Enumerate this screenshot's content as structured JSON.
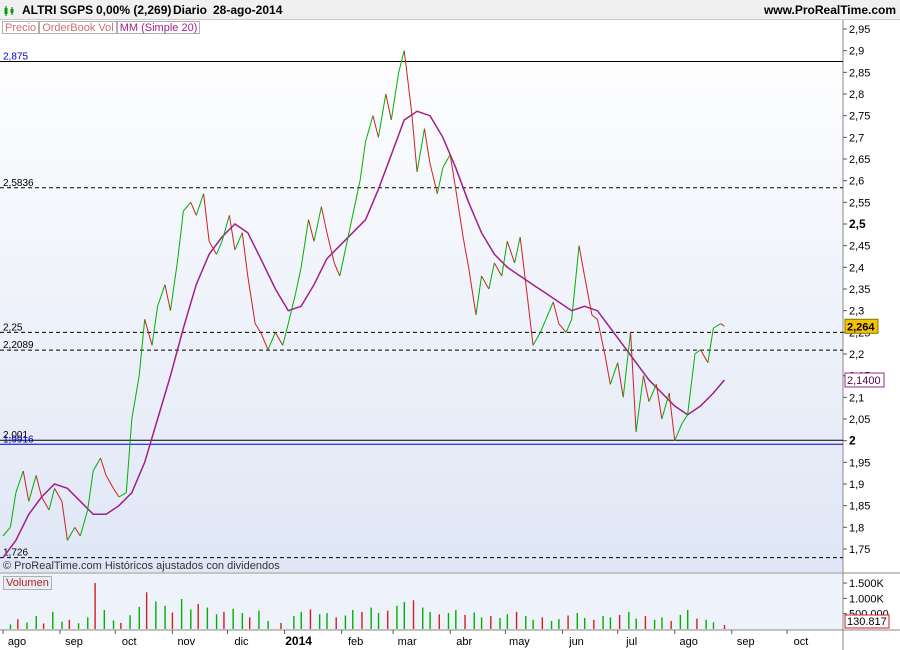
{
  "header": {
    "ticker": "ALTRI SGPS",
    "change": "0,00% (2,269)",
    "period": "Diario",
    "date": "28-ago-2014",
    "site": "www.ProRealTime.com"
  },
  "legend": {
    "price": "Precio",
    "orderbook": "OrderBook Vol",
    "ma": "MM (Simple 20)"
  },
  "footer_note": "© ProRealTime.com  Históricos ajustados con dividendos",
  "volume_label": "Volumen",
  "colors": {
    "up": "#00b000",
    "down": "#d02020",
    "ma": "#a0208a",
    "price_panel_top": "#ffffff",
    "price_panel_bottom": "#dfe6f5",
    "level_2": "#0000cc",
    "price_badge": "#f5c400"
  },
  "chart_data": {
    "type": "line",
    "x_months": [
      "ago",
      "sep",
      "oct",
      "nov",
      "dic",
      "2014",
      "feb",
      "mar",
      "abr",
      "may",
      "jun",
      "jul",
      "ago",
      "sep",
      "oct"
    ],
    "y_ticks": [
      "2,95",
      "2,9",
      "2,85",
      "2,8",
      "2,75",
      "2,7",
      "2,65",
      "2,6",
      "2,55",
      "2,5",
      "2,45",
      "2,4",
      "2,35",
      "2,3",
      "2,25",
      "2,2",
      "2,15",
      "2,1",
      "2,05",
      "2",
      "1,95",
      "1,9",
      "1,85",
      "1,8",
      "1,75"
    ],
    "ylim": [
      1.72,
      2.96
    ],
    "current_price_label": "2,264",
    "current_ma_label": "2,1400",
    "levels": [
      {
        "label": "2,875",
        "value": 2.875,
        "style": "solid"
      },
      {
        "label": "2,5836",
        "value": 2.5836,
        "style": "dashed"
      },
      {
        "label": "2,25",
        "value": 2.25,
        "style": "dashed"
      },
      {
        "label": "2,2089",
        "value": 2.2089,
        "style": "dashed"
      },
      {
        "label": "2,001",
        "value": 2.001,
        "style": "solid"
      },
      {
        "label": "1,9916",
        "value": 1.9916,
        "style": "solid-blue"
      },
      {
        "label": "1,726",
        "value": 1.73,
        "style": "dashed"
      }
    ],
    "price_series": [
      {
        "date": "2013-08-01",
        "value": 1.78
      },
      {
        "date": "2013-08-05",
        "value": 1.8
      },
      {
        "date": "2013-08-08",
        "value": 1.88
      },
      {
        "date": "2013-08-12",
        "value": 1.93
      },
      {
        "date": "2013-08-15",
        "value": 1.86
      },
      {
        "date": "2013-08-19",
        "value": 1.92
      },
      {
        "date": "2013-08-22",
        "value": 1.87
      },
      {
        "date": "2013-08-26",
        "value": 1.84
      },
      {
        "date": "2013-08-29",
        "value": 1.89
      },
      {
        "date": "2013-09-02",
        "value": 1.86
      },
      {
        "date": "2013-09-05",
        "value": 1.77
      },
      {
        "date": "2013-09-09",
        "value": 1.8
      },
      {
        "date": "2013-09-12",
        "value": 1.78
      },
      {
        "date": "2013-09-16",
        "value": 1.84
      },
      {
        "date": "2013-09-19",
        "value": 1.93
      },
      {
        "date": "2013-09-23",
        "value": 1.96
      },
      {
        "date": "2013-09-26",
        "value": 1.92
      },
      {
        "date": "2013-09-30",
        "value": 1.89
      },
      {
        "date": "2013-10-03",
        "value": 1.87
      },
      {
        "date": "2013-10-07",
        "value": 1.88
      },
      {
        "date": "2013-10-10",
        "value": 2.05
      },
      {
        "date": "2013-10-14",
        "value": 2.15
      },
      {
        "date": "2013-10-17",
        "value": 2.28
      },
      {
        "date": "2013-10-21",
        "value": 2.22
      },
      {
        "date": "2013-10-24",
        "value": 2.31
      },
      {
        "date": "2013-10-28",
        "value": 2.36
      },
      {
        "date": "2013-10-31",
        "value": 2.3
      },
      {
        "date": "2013-11-04",
        "value": 2.42
      },
      {
        "date": "2013-11-07",
        "value": 2.53
      },
      {
        "date": "2013-11-11",
        "value": 2.55
      },
      {
        "date": "2013-11-14",
        "value": 2.52
      },
      {
        "date": "2013-11-18",
        "value": 2.57
      },
      {
        "date": "2013-11-21",
        "value": 2.46
      },
      {
        "date": "2013-11-25",
        "value": 2.43
      },
      {
        "date": "2013-11-28",
        "value": 2.46
      },
      {
        "date": "2013-12-02",
        "value": 2.52
      },
      {
        "date": "2013-12-05",
        "value": 2.44
      },
      {
        "date": "2013-12-09",
        "value": 2.48
      },
      {
        "date": "2013-12-12",
        "value": 2.38
      },
      {
        "date": "2013-12-16",
        "value": 2.27
      },
      {
        "date": "2013-12-19",
        "value": 2.25
      },
      {
        "date": "2013-12-23",
        "value": 2.21
      },
      {
        "date": "2013-12-27",
        "value": 2.25
      },
      {
        "date": "2013-12-31",
        "value": 2.22
      },
      {
        "date": "2014-01-03",
        "value": 2.27
      },
      {
        "date": "2014-01-07",
        "value": 2.34
      },
      {
        "date": "2014-01-10",
        "value": 2.4
      },
      {
        "date": "2014-01-14",
        "value": 2.51
      },
      {
        "date": "2014-01-17",
        "value": 2.46
      },
      {
        "date": "2014-01-21",
        "value": 2.54
      },
      {
        "date": "2014-01-24",
        "value": 2.48
      },
      {
        "date": "2014-01-28",
        "value": 2.41
      },
      {
        "date": "2014-01-31",
        "value": 2.38
      },
      {
        "date": "2014-02-04",
        "value": 2.46
      },
      {
        "date": "2014-02-07",
        "value": 2.52
      },
      {
        "date": "2014-02-11",
        "value": 2.6
      },
      {
        "date": "2014-02-14",
        "value": 2.69
      },
      {
        "date": "2014-02-18",
        "value": 2.75
      },
      {
        "date": "2014-02-21",
        "value": 2.7
      },
      {
        "date": "2014-02-25",
        "value": 2.8
      },
      {
        "date": "2014-02-28",
        "value": 2.74
      },
      {
        "date": "2014-03-04",
        "value": 2.85
      },
      {
        "date": "2014-03-07",
        "value": 2.9
      },
      {
        "date": "2014-03-11",
        "value": 2.76
      },
      {
        "date": "2014-03-14",
        "value": 2.62
      },
      {
        "date": "2014-03-18",
        "value": 2.72
      },
      {
        "date": "2014-03-21",
        "value": 2.64
      },
      {
        "date": "2014-03-25",
        "value": 2.57
      },
      {
        "date": "2014-03-28",
        "value": 2.63
      },
      {
        "date": "2014-04-01",
        "value": 2.66
      },
      {
        "date": "2014-04-04",
        "value": 2.58
      },
      {
        "date": "2014-04-08",
        "value": 2.47
      },
      {
        "date": "2014-04-11",
        "value": 2.4
      },
      {
        "date": "2014-04-15",
        "value": 2.29
      },
      {
        "date": "2014-04-18",
        "value": 2.38
      },
      {
        "date": "2014-04-22",
        "value": 2.35
      },
      {
        "date": "2014-04-25",
        "value": 2.41
      },
      {
        "date": "2014-04-29",
        "value": 2.38
      },
      {
        "date": "2014-05-02",
        "value": 2.46
      },
      {
        "date": "2014-05-06",
        "value": 2.41
      },
      {
        "date": "2014-05-09",
        "value": 2.47
      },
      {
        "date": "2014-05-13",
        "value": 2.33
      },
      {
        "date": "2014-05-16",
        "value": 2.22
      },
      {
        "date": "2014-05-20",
        "value": 2.25
      },
      {
        "date": "2014-05-23",
        "value": 2.28
      },
      {
        "date": "2014-05-27",
        "value": 2.32
      },
      {
        "date": "2014-05-30",
        "value": 2.27
      },
      {
        "date": "2014-06-03",
        "value": 2.25
      },
      {
        "date": "2014-06-06",
        "value": 2.28
      },
      {
        "date": "2014-06-10",
        "value": 2.45
      },
      {
        "date": "2014-06-13",
        "value": 2.38
      },
      {
        "date": "2014-06-17",
        "value": 2.29
      },
      {
        "date": "2014-06-20",
        "value": 2.28
      },
      {
        "date": "2014-06-24",
        "value": 2.2
      },
      {
        "date": "2014-06-27",
        "value": 2.13
      },
      {
        "date": "2014-07-01",
        "value": 2.18
      },
      {
        "date": "2014-07-04",
        "value": 2.1
      },
      {
        "date": "2014-07-08",
        "value": 2.25
      },
      {
        "date": "2014-07-11",
        "value": 2.02
      },
      {
        "date": "2014-07-15",
        "value": 2.15
      },
      {
        "date": "2014-07-18",
        "value": 2.09
      },
      {
        "date": "2014-07-22",
        "value": 2.13
      },
      {
        "date": "2014-07-25",
        "value": 2.05
      },
      {
        "date": "2014-07-29",
        "value": 2.11
      },
      {
        "date": "2014-08-01",
        "value": 2.0
      },
      {
        "date": "2014-08-05",
        "value": 2.04
      },
      {
        "date": "2014-08-08",
        "value": 2.06
      },
      {
        "date": "2014-08-12",
        "value": 2.2
      },
      {
        "date": "2014-08-15",
        "value": 2.21
      },
      {
        "date": "2014-08-19",
        "value": 2.18
      },
      {
        "date": "2014-08-22",
        "value": 2.26
      },
      {
        "date": "2014-08-26",
        "value": 2.27
      },
      {
        "date": "2014-08-28",
        "value": 2.264
      }
    ],
    "ma_series": [
      {
        "date": "2013-08-01",
        "value": 1.73
      },
      {
        "date": "2013-08-08",
        "value": 1.77
      },
      {
        "date": "2013-08-15",
        "value": 1.83
      },
      {
        "date": "2013-08-22",
        "value": 1.87
      },
      {
        "date": "2013-08-29",
        "value": 1.9
      },
      {
        "date": "2013-09-05",
        "value": 1.89
      },
      {
        "date": "2013-09-12",
        "value": 1.86
      },
      {
        "date": "2013-09-19",
        "value": 1.83
      },
      {
        "date": "2013-09-26",
        "value": 1.83
      },
      {
        "date": "2013-10-03",
        "value": 1.85
      },
      {
        "date": "2013-10-10",
        "value": 1.88
      },
      {
        "date": "2013-10-17",
        "value": 1.95
      },
      {
        "date": "2013-10-24",
        "value": 2.05
      },
      {
        "date": "2013-10-31",
        "value": 2.15
      },
      {
        "date": "2013-11-07",
        "value": 2.26
      },
      {
        "date": "2013-11-14",
        "value": 2.36
      },
      {
        "date": "2013-11-21",
        "value": 2.43
      },
      {
        "date": "2013-11-28",
        "value": 2.47
      },
      {
        "date": "2013-12-05",
        "value": 2.5
      },
      {
        "date": "2013-12-12",
        "value": 2.48
      },
      {
        "date": "2013-12-19",
        "value": 2.42
      },
      {
        "date": "2013-12-27",
        "value": 2.35
      },
      {
        "date": "2014-01-03",
        "value": 2.3
      },
      {
        "date": "2014-01-10",
        "value": 2.31
      },
      {
        "date": "2014-01-17",
        "value": 2.36
      },
      {
        "date": "2014-01-24",
        "value": 2.42
      },
      {
        "date": "2014-01-31",
        "value": 2.45
      },
      {
        "date": "2014-02-07",
        "value": 2.48
      },
      {
        "date": "2014-02-14",
        "value": 2.51
      },
      {
        "date": "2014-02-21",
        "value": 2.58
      },
      {
        "date": "2014-02-28",
        "value": 2.66
      },
      {
        "date": "2014-03-07",
        "value": 2.74
      },
      {
        "date": "2014-03-14",
        "value": 2.76
      },
      {
        "date": "2014-03-21",
        "value": 2.75
      },
      {
        "date": "2014-03-28",
        "value": 2.7
      },
      {
        "date": "2014-04-04",
        "value": 2.63
      },
      {
        "date": "2014-04-11",
        "value": 2.55
      },
      {
        "date": "2014-04-18",
        "value": 2.48
      },
      {
        "date": "2014-04-25",
        "value": 2.43
      },
      {
        "date": "2014-05-02",
        "value": 2.4
      },
      {
        "date": "2014-05-09",
        "value": 2.38
      },
      {
        "date": "2014-05-16",
        "value": 2.36
      },
      {
        "date": "2014-05-23",
        "value": 2.34
      },
      {
        "date": "2014-05-30",
        "value": 2.32
      },
      {
        "date": "2014-06-06",
        "value": 2.3
      },
      {
        "date": "2014-06-13",
        "value": 2.31
      },
      {
        "date": "2014-06-20",
        "value": 2.3
      },
      {
        "date": "2014-06-27",
        "value": 2.26
      },
      {
        "date": "2014-07-04",
        "value": 2.22
      },
      {
        "date": "2014-07-11",
        "value": 2.18
      },
      {
        "date": "2014-07-18",
        "value": 2.14
      },
      {
        "date": "2014-07-25",
        "value": 2.11
      },
      {
        "date": "2014-08-01",
        "value": 2.08
      },
      {
        "date": "2014-08-08",
        "value": 2.06
      },
      {
        "date": "2014-08-15",
        "value": 2.08
      },
      {
        "date": "2014-08-22",
        "value": 2.11
      },
      {
        "date": "2014-08-28",
        "value": 2.14
      }
    ],
    "volume_ticks": [
      "1.500K",
      "1.000K",
      "500.000"
    ],
    "volume_last_label": "130.817",
    "volume_ylim": [
      0,
      1600000
    ],
    "volume_series": [
      {
        "date": "2013-08-05",
        "value": 150000
      },
      {
        "date": "2013-08-09",
        "value": 320000
      },
      {
        "date": "2013-08-14",
        "value": 210000
      },
      {
        "date": "2013-08-19",
        "value": 420000
      },
      {
        "date": "2013-08-23",
        "value": 180000
      },
      {
        "date": "2013-08-28",
        "value": 560000
      },
      {
        "date": "2013-09-02",
        "value": 240000
      },
      {
        "date": "2013-09-06",
        "value": 300000
      },
      {
        "date": "2013-09-11",
        "value": 190000
      },
      {
        "date": "2013-09-16",
        "value": 380000
      },
      {
        "date": "2013-09-20",
        "value": 1500000
      },
      {
        "date": "2013-09-25",
        "value": 620000
      },
      {
        "date": "2013-09-30",
        "value": 280000
      },
      {
        "date": "2013-10-04",
        "value": 200000
      },
      {
        "date": "2013-10-09",
        "value": 450000
      },
      {
        "date": "2013-10-14",
        "value": 720000
      },
      {
        "date": "2013-10-18",
        "value": 1200000
      },
      {
        "date": "2013-10-23",
        "value": 900000
      },
      {
        "date": "2013-10-28",
        "value": 760000
      },
      {
        "date": "2013-11-01",
        "value": 540000
      },
      {
        "date": "2013-11-06",
        "value": 980000
      },
      {
        "date": "2013-11-11",
        "value": 640000
      },
      {
        "date": "2013-11-15",
        "value": 820000
      },
      {
        "date": "2013-11-20",
        "value": 700000
      },
      {
        "date": "2013-11-25",
        "value": 480000
      },
      {
        "date": "2013-11-29",
        "value": 560000
      },
      {
        "date": "2013-12-04",
        "value": 660000
      },
      {
        "date": "2013-12-09",
        "value": 520000
      },
      {
        "date": "2013-12-13",
        "value": 380000
      },
      {
        "date": "2013-12-18",
        "value": 600000
      },
      {
        "date": "2013-12-23",
        "value": 260000
      },
      {
        "date": "2013-12-30",
        "value": 200000
      },
      {
        "date": "2014-01-06",
        "value": 420000
      },
      {
        "date": "2014-01-10",
        "value": 560000
      },
      {
        "date": "2014-01-15",
        "value": 640000
      },
      {
        "date": "2014-01-20",
        "value": 480000
      },
      {
        "date": "2014-01-24",
        "value": 520000
      },
      {
        "date": "2014-01-29",
        "value": 380000
      },
      {
        "date": "2014-02-03",
        "value": 440000
      },
      {
        "date": "2014-02-07",
        "value": 620000
      },
      {
        "date": "2014-02-12",
        "value": 560000
      },
      {
        "date": "2014-02-17",
        "value": 700000
      },
      {
        "date": "2014-02-21",
        "value": 520000
      },
      {
        "date": "2014-02-26",
        "value": 600000
      },
      {
        "date": "2014-03-03",
        "value": 760000
      },
      {
        "date": "2014-03-07",
        "value": 880000
      },
      {
        "date": "2014-03-12",
        "value": 940000
      },
      {
        "date": "2014-03-17",
        "value": 700000
      },
      {
        "date": "2014-03-21",
        "value": 560000
      },
      {
        "date": "2014-03-26",
        "value": 480000
      },
      {
        "date": "2014-03-31",
        "value": 520000
      },
      {
        "date": "2014-04-04",
        "value": 620000
      },
      {
        "date": "2014-04-09",
        "value": 460000
      },
      {
        "date": "2014-04-14",
        "value": 540000
      },
      {
        "date": "2014-04-18",
        "value": 380000
      },
      {
        "date": "2014-04-23",
        "value": 420000
      },
      {
        "date": "2014-04-28",
        "value": 360000
      },
      {
        "date": "2014-05-02",
        "value": 480000
      },
      {
        "date": "2014-05-07",
        "value": 560000
      },
      {
        "date": "2014-05-12",
        "value": 420000
      },
      {
        "date": "2014-05-16",
        "value": 300000
      },
      {
        "date": "2014-05-21",
        "value": 380000
      },
      {
        "date": "2014-05-26",
        "value": 260000
      },
      {
        "date": "2014-05-30",
        "value": 320000
      },
      {
        "date": "2014-06-04",
        "value": 440000
      },
      {
        "date": "2014-06-09",
        "value": 520000
      },
      {
        "date": "2014-06-13",
        "value": 360000
      },
      {
        "date": "2014-06-18",
        "value": 300000
      },
      {
        "date": "2014-06-23",
        "value": 420000
      },
      {
        "date": "2014-06-27",
        "value": 380000
      },
      {
        "date": "2014-07-02",
        "value": 460000
      },
      {
        "date": "2014-07-07",
        "value": 560000
      },
      {
        "date": "2014-07-11",
        "value": 340000
      },
      {
        "date": "2014-07-16",
        "value": 420000
      },
      {
        "date": "2014-07-21",
        "value": 300000
      },
      {
        "date": "2014-07-25",
        "value": 380000
      },
      {
        "date": "2014-07-30",
        "value": 260000
      },
      {
        "date": "2014-08-04",
        "value": 460000
      },
      {
        "date": "2014-08-08",
        "value": 620000
      },
      {
        "date": "2014-08-13",
        "value": 340000
      },
      {
        "date": "2014-08-18",
        "value": 300000
      },
      {
        "date": "2014-08-22",
        "value": 220000
      },
      {
        "date": "2014-08-28",
        "value": 130817
      }
    ]
  }
}
